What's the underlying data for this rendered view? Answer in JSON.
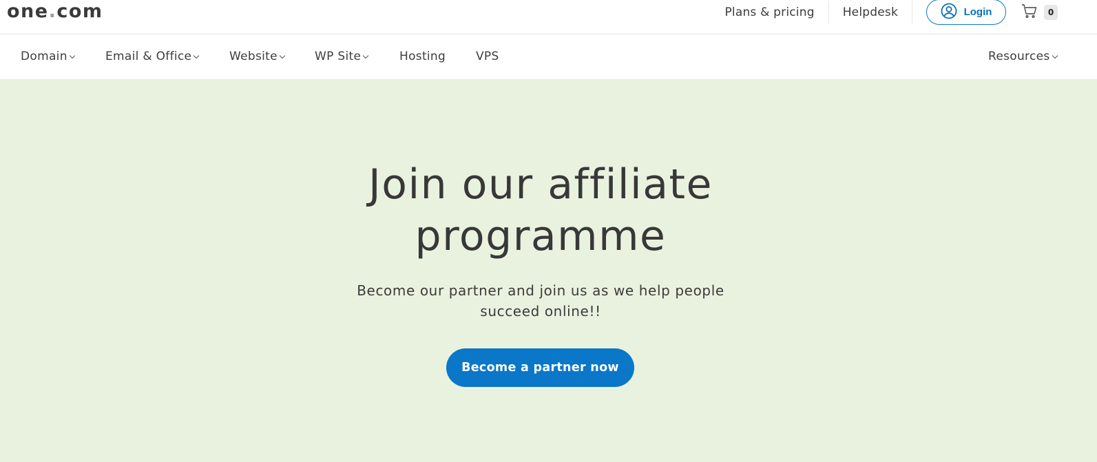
{
  "brand": {
    "name_part1": "one",
    "dot": ".",
    "name_part2": "com",
    "accent_color": "#0a77c8",
    "hero_background": "#e9f2df"
  },
  "topbar": {
    "links": [
      {
        "label": "Plans & pricing"
      },
      {
        "label": "Helpdesk"
      }
    ],
    "login_label": "Login",
    "login_icon": "user-circle-icon",
    "cart_icon": "shopping-cart-icon",
    "cart_count": "0"
  },
  "mainnav": {
    "items": [
      {
        "label": "Domain",
        "has_dropdown": true
      },
      {
        "label": "Email & Office",
        "has_dropdown": true
      },
      {
        "label": "Website",
        "has_dropdown": true
      },
      {
        "label": "WP Site",
        "has_dropdown": true
      },
      {
        "label": "Hosting",
        "has_dropdown": false
      },
      {
        "label": "VPS",
        "has_dropdown": false
      }
    ],
    "right_item": {
      "label": "Resources",
      "has_dropdown": true
    }
  },
  "hero": {
    "title_line1": "Join our affiliate",
    "title_line2": "programme",
    "subtitle_line1": "Become our partner and join us as we help people",
    "subtitle_line2": "succeed online!!",
    "cta_label": "Become a partner now"
  }
}
